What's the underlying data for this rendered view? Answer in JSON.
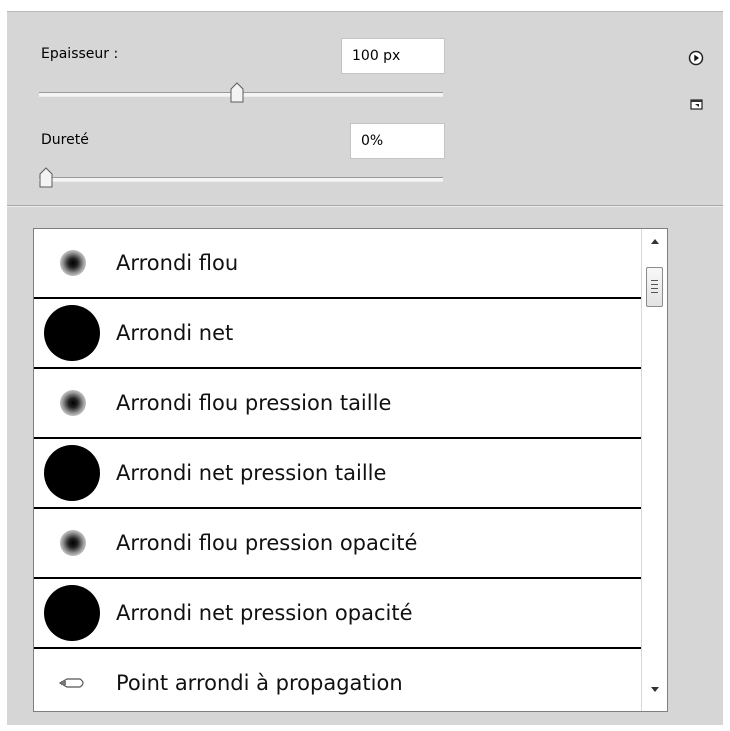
{
  "size": {
    "label": "Epaisseur :",
    "value": "100 px",
    "slider_fraction": 0.49
  },
  "hardness": {
    "label": "Dureté",
    "value": "0%",
    "slider_fraction": 0.0
  },
  "header_icons": {
    "menu": "flyout-menu-icon",
    "new_preset": "new-preset-icon"
  },
  "presets": [
    {
      "name": "Arrondi flou",
      "tip": "soft-round"
    },
    {
      "name": "Arrondi net",
      "tip": "hard-round"
    },
    {
      "name": "Arrondi flou pression taille",
      "tip": "soft-round"
    },
    {
      "name": "Arrondi net pression taille",
      "tip": "hard-round"
    },
    {
      "name": "Arrondi flou pression opacité",
      "tip": "soft-round"
    },
    {
      "name": "Arrondi net pression opacité",
      "tip": "hard-round"
    },
    {
      "name": "Point arrondi à propagation",
      "tip": "airbrush-tip"
    }
  ],
  "colors": {
    "panel_bg": "#d6d6d6",
    "list_bg": "#ffffff",
    "separator": "#000000"
  }
}
